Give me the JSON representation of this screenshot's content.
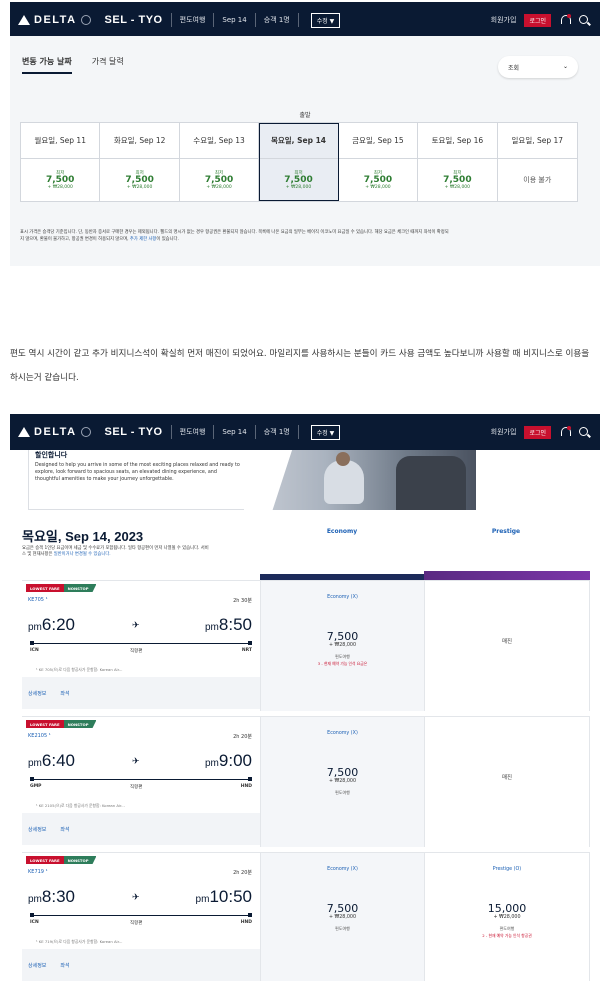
{
  "header": {
    "brand": "DELTA",
    "route": "SEL - TYO",
    "trip_type": "편도여행",
    "date": "Sep 14",
    "passengers": "승객 1명",
    "edit_label": "수정 ▼",
    "signup": "회원가입",
    "login": "로그인"
  },
  "shot1": {
    "tabs": [
      "변동 가능 날짜",
      "가격 달력"
    ],
    "sort_label": "조회",
    "depart_label": "출발",
    "dates": [
      {
        "label": "월요일, Sep 11",
        "small": "최저",
        "miles": "7,500",
        "won": "+ ₩28,000"
      },
      {
        "label": "화요일, Sep 12",
        "small": "최저",
        "miles": "7,500",
        "won": "+ ₩28,000"
      },
      {
        "label": "수요일, Sep 13",
        "small": "최저",
        "miles": "7,500",
        "won": "+ ₩28,000"
      },
      {
        "label": "목요일, Sep 14",
        "small": "최저",
        "miles": "7,500",
        "won": "+ ₩28,000"
      },
      {
        "label": "금요일, Sep 15",
        "small": "최저",
        "miles": "7,500",
        "won": "+ ₩28,000"
      },
      {
        "label": "토요일, Sep 16",
        "small": "최저",
        "miles": "7,500",
        "won": "+ ₩28,000"
      },
      {
        "label": "일요일, Sep 17",
        "na": "이용 불가"
      }
    ],
    "disclaimer_1": "표시 가격은 승객당 기준입니다. 단, 동반자 증서로 구매한 경우는 제외됩니다. 펠드의 명시가 없는 경우 항공권은 환불되지 않습니다. 목록에 나온 요금의 일부는 베이직 이코노미 요금일 수 있습니다. 해당 요금은 체크인 때까지 좌석이 확정되",
    "disclaimer_2": "지 않으며, 환불이 불가하고, 항공권 변경이 허용되지 않으며,",
    "disclaimer_link": "추가 제한 사항",
    "disclaimer_3": "이 있습니다."
  },
  "paragraph": "편도 역시 시간이 같고 추가 비지니스석이 확실히 먼저 매진이 되었어요. 마일리지를 사용하시는 분들이 카드 사용 금액도 높다보니까 사용할 때 비지니스로 이용을 하시는거 같습니다.",
  "shot2": {
    "hero_title": "할인합니다",
    "hero_text": "Designed to help you arrive in some of the most exciting places relaxed and ready to explore, look forward to spacious seats, an elevated dining experience, and thoughtful amenities to make your journey unforgettable.",
    "date_title": "목요일, Sep 14, 2023",
    "date_sub_1": "요금은 승객 1인당 요금이며 세금 및 수수료가 포함됩니다. 일타 항공편이 먼저 나열될 수 있습니다. 서비",
    "date_sub_2": "스 및 현재사항은",
    "date_sub_link": "일반이거나 변경될 수 있습니다.",
    "cabins": [
      "Economy",
      "Prestige"
    ],
    "flights": [
      {
        "badge_fare": "LOWEST FARE",
        "badge_stop": "NONSTOP",
        "number": "KE705 ¹",
        "duration": "2h 30분",
        "dep_ampm": "pm",
        "dep_time": "6:20",
        "arr_ampm": "pm",
        "arr_time": "8:50",
        "from": "ICN",
        "to": "NRT",
        "mid": "직항편",
        "note": "¹  KE 705(으)로 다음 항공사가 운항함: Korean Air...",
        "detail": "상세정보",
        "seat": "좌석",
        "eco_tag": "Economy (X)",
        "eco_miles": "7,500",
        "eco_won": "+ ₩28,000",
        "eco_type": "편도여행",
        "eco_warn": "3 - 현재 예약 가능 인석 요금은",
        "pre_sold": "매진"
      },
      {
        "badge_fare": "LOWEST FARE",
        "badge_stop": "NONSTOP",
        "number": "KE2105 ¹",
        "duration": "2h 20분",
        "dep_ampm": "pm",
        "dep_time": "6:40",
        "arr_ampm": "pm",
        "arr_time": "9:00",
        "from": "GMP",
        "to": "HND",
        "mid": "직항편",
        "note": "¹  KE 2105(으)로 다음 항공사가 운항함: Korean Air...",
        "detail": "상세정보",
        "seat": "좌석",
        "eco_tag": "Economy (X)",
        "eco_miles": "7,500",
        "eco_won": "+ ₩28,000",
        "eco_type": "편도여행",
        "eco_warn": "",
        "pre_sold": "매진"
      },
      {
        "badge_fare": "LOWEST FARE",
        "badge_stop": "NONSTOP",
        "number": "KE719 ¹",
        "duration": "2h 20분",
        "dep_ampm": "pm",
        "dep_time": "8:30",
        "arr_ampm": "pm",
        "arr_time": "10:50",
        "from": "ICN",
        "to": "HND",
        "mid": "직항편",
        "note": "¹  KE 719(으)로 다음 항공사가 운항함: Korean Air...",
        "detail": "상세정보",
        "seat": "좌석",
        "eco_tag": "Economy (X)",
        "eco_miles": "7,500",
        "eco_won": "+ ₩28,000",
        "eco_type": "편도여행",
        "eco_warn": "",
        "pre_tag": "Prestige (O)",
        "pre_miles": "15,000",
        "pre_won": "+ ₩28,000",
        "pre_type": "편도여행",
        "pre_warn": "2 - 현재 예약 가능 인석 항공권"
      }
    ]
  },
  "colors": {
    "navy": "#0a1a33",
    "red": "#c8102e",
    "green": "#2e7d32",
    "purple": "#7b35a8"
  }
}
